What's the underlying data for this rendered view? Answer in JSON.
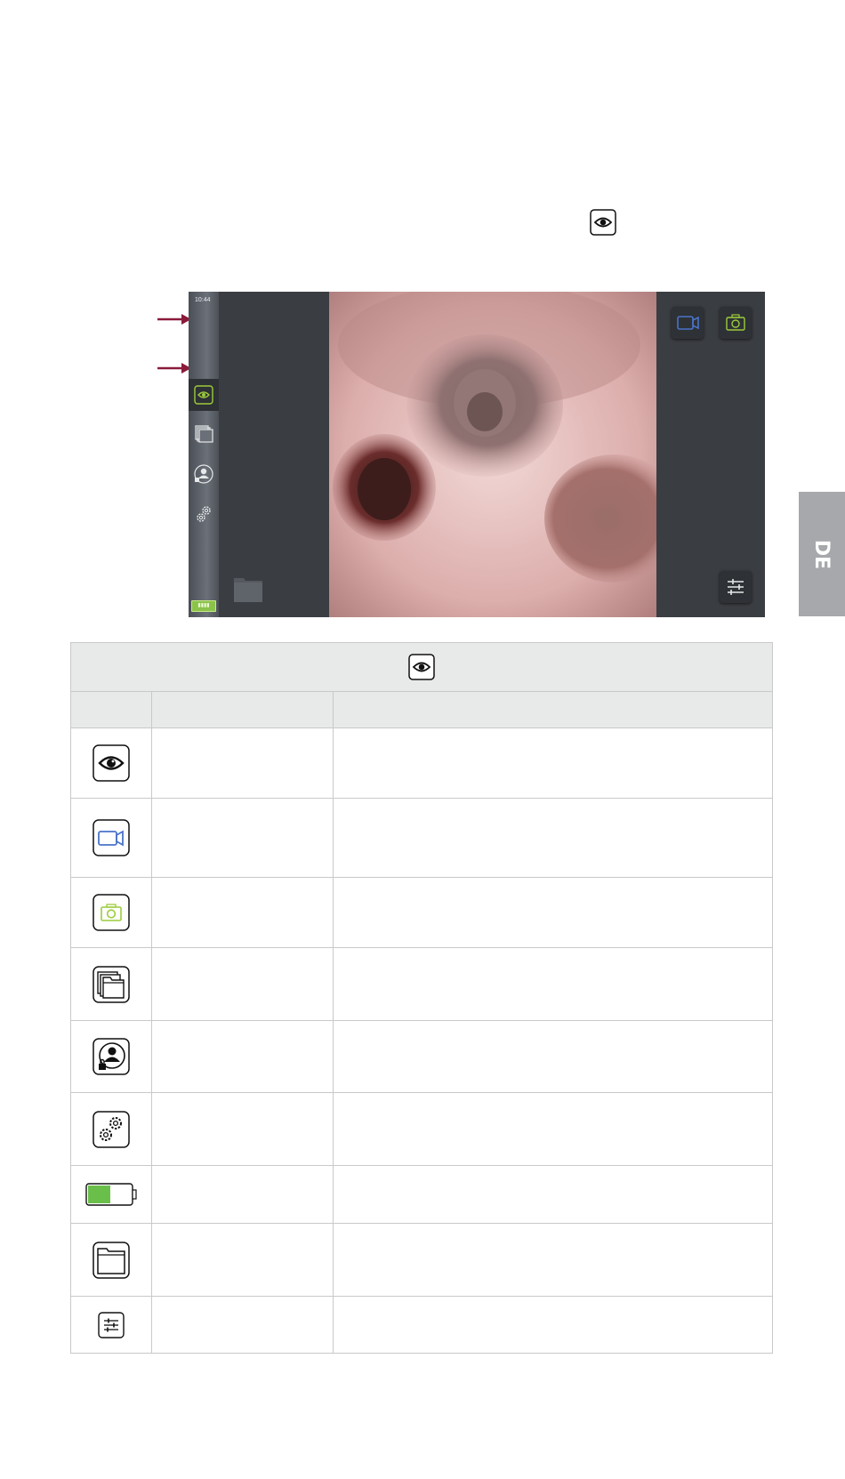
{
  "screen": {
    "time": "10:44",
    "battery_label": "▮▮▮▮"
  },
  "language_tab": "DE",
  "legend_table": {
    "header_icon": "eye-icon",
    "columns": [
      "",
      "",
      ""
    ],
    "rows": [
      {
        "icon": "eye-icon",
        "name": "",
        "description": ""
      },
      {
        "icon": "video-camera-icon",
        "name": "",
        "description": ""
      },
      {
        "icon": "photo-camera-icon",
        "name": "",
        "description": ""
      },
      {
        "icon": "archive-folders-icon",
        "name": "",
        "description": ""
      },
      {
        "icon": "user-login-icon",
        "name": "",
        "description": ""
      },
      {
        "icon": "settings-gears-icon",
        "name": "",
        "description": ""
      },
      {
        "icon": "battery-icon",
        "name": "",
        "description": ""
      },
      {
        "icon": "folder-icon",
        "name": "",
        "description": ""
      },
      {
        "icon": "adjust-sliders-icon",
        "name": "",
        "description": ""
      }
    ]
  },
  "colors": {
    "arrow": "#8b1a3a",
    "accent_green": "#9ccc3c",
    "accent_blue": "#4a74c9",
    "battery_fill": "#6abf4b",
    "tab_gray": "#a6a8ab"
  }
}
